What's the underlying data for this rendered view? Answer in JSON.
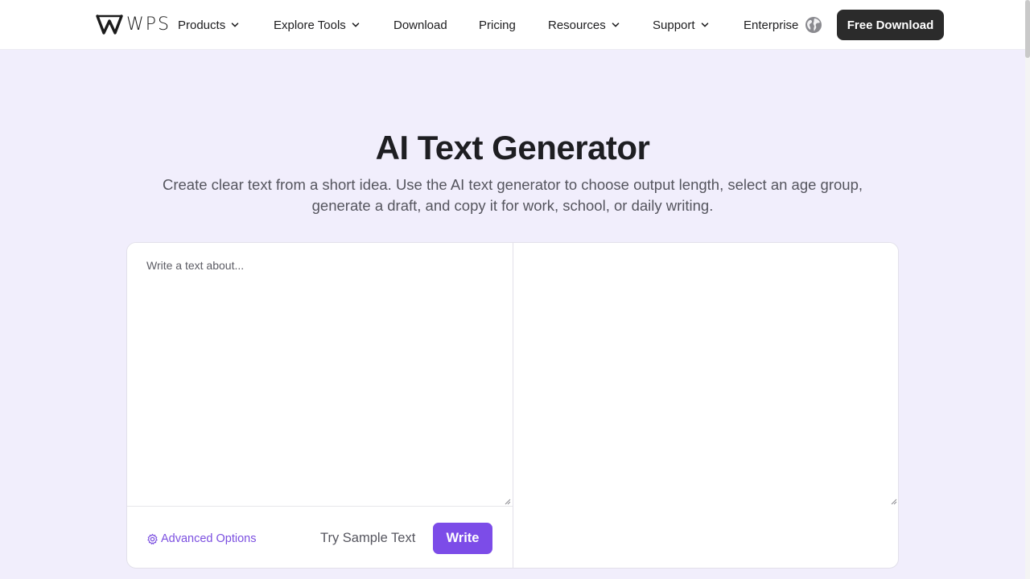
{
  "header": {
    "logo_text": "WPS",
    "nav": [
      {
        "label": "Products",
        "dropdown": true
      },
      {
        "label": "Explore Tools",
        "dropdown": true
      },
      {
        "label": "Download",
        "dropdown": false
      },
      {
        "label": "Pricing",
        "dropdown": false
      },
      {
        "label": "Resources",
        "dropdown": true
      },
      {
        "label": "Support",
        "dropdown": true
      },
      {
        "label": "Enterprise",
        "dropdown": false
      }
    ],
    "globe_icon": "globe-icon",
    "cta_label": "Free Download"
  },
  "hero": {
    "title": "AI Text Generator",
    "subtitle": "Create clear text from a short idea. Use the AI text generator to choose output length, select an age group, generate a draft, and copy it for work, school, or daily writing."
  },
  "editor": {
    "input_placeholder": "Write a text about...",
    "input_value": "",
    "output_value": "",
    "advanced_options_label": "Advanced Options",
    "advanced_icon": "gear-icon",
    "sample_label": "Try Sample Text",
    "write_label": "Write"
  },
  "colors": {
    "accent": "#7c4ce8",
    "page_bg": "#f1eefc",
    "cta_bg": "#2b2b2b"
  }
}
